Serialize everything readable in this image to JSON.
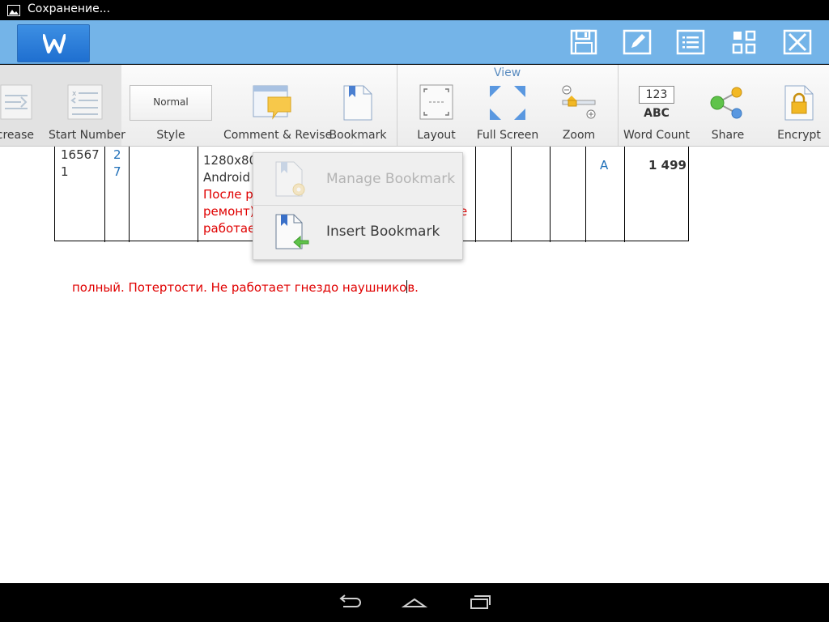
{
  "status_bar": {
    "title": "Сохранение..."
  },
  "header": {
    "logo_letter": "W",
    "buttons": [
      "save-icon",
      "edit-icon",
      "list-icon",
      "grid-icon",
      "close-icon"
    ]
  },
  "ribbon": {
    "increase_label": "crease",
    "start_number_label": "Start Number",
    "style_label": "Style",
    "style_preview": "Normal",
    "comment_label": "Comment & Revise",
    "bookmark_label": "Bookmark",
    "view_group_label": "View",
    "layout_label": "Layout",
    "fullscreen_label": "Full Screen",
    "zoom_label": "Zoom",
    "word_count_label": "Word Count",
    "word_count_icon_top": "123",
    "word_count_icon_bottom": "ABC",
    "share_label": "Share",
    "encrypt_label": "Encrypt"
  },
  "document": {
    "cell_code_line1": "16567",
    "cell_code_line2": "1",
    "cell_num_line1": "2",
    "cell_num_line2": "7",
    "desc_line1": "1280x80",
    "desc_line2": "Android",
    "desc_red_line1": "После ре",
    "desc_red_line2": "ремонт).",
    "desc_red_line2_end": "е",
    "desc_red_line3": "работает",
    "grade": "A",
    "price": "1 499",
    "body_line_before_cursor": "полный. Потертости. Не работает гнездо наушнико",
    "body_line_after_cursor": "в."
  },
  "bookmark_menu": {
    "manage_label": "Manage Bookmark",
    "insert_label": "Insert Bookmark"
  },
  "colors": {
    "header_bg": "#74b4e8",
    "accent_blue": "#1f6fb8",
    "red_text": "#e00000"
  }
}
